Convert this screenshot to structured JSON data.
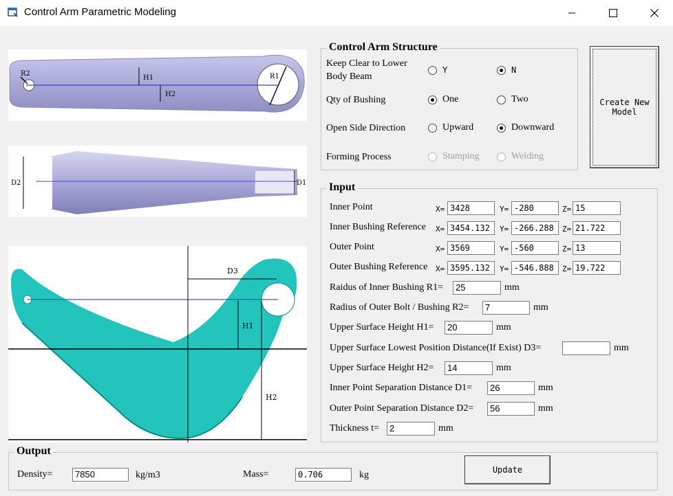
{
  "window": {
    "title": "Control Arm Parametric Modeling"
  },
  "figures": {
    "top": {
      "r2": "R2",
      "h1": "H1",
      "h2": "H2",
      "r1": "R1"
    },
    "side": {
      "d2": "D2",
      "d1": "D1"
    },
    "front": {
      "d3": "D3",
      "h1": "H1",
      "h2": "H2"
    }
  },
  "structure": {
    "title": "Control Arm Structure",
    "keep_clear_line1": "Keep Clear to Lower",
    "keep_clear_line2": "Body Beam",
    "keep_clear_options": [
      "Y",
      "N"
    ],
    "qty_label": "Qty of Bushing",
    "qty_options": [
      "One",
      "Two"
    ],
    "open_side_label": "Open Side Direction",
    "open_side_options": [
      "Upward",
      "Downward"
    ],
    "forming_label": "Forming Process",
    "forming_options": [
      "Stamping",
      "Welding"
    ],
    "create_button": "Create New Model"
  },
  "input": {
    "title": "Input",
    "inner_point": {
      "label": "Inner Point",
      "x": "3428",
      "y": "-280",
      "z": "15"
    },
    "inner_bushing_ref": {
      "label": "Inner Bushing Reference",
      "x": "3454.132",
      "y": "-266.288",
      "z": "21.722"
    },
    "outer_point": {
      "label": "Outer Point",
      "x": "3569",
      "y": "-560",
      "z": "13"
    },
    "outer_bushing_ref": {
      "label": "Outer Bushing Reference",
      "x": "3595.132",
      "y": "-546.888",
      "z": "19.722"
    },
    "r1": {
      "label": "Raidus of Inner Bushing R1=",
      "value": "25",
      "unit": "mm"
    },
    "r2": {
      "label": "Radius of Outer Bolt / Bushing R2=",
      "value": "7",
      "unit": "mm"
    },
    "h1": {
      "label": "Upper Surface Height H1=",
      "value": "20",
      "unit": "mm"
    },
    "d3": {
      "label": "Upper Surface Lowest Position Distance(If Exist) D3=",
      "value": "",
      "unit": "mm"
    },
    "h2": {
      "label": "Upper Surface Height H2=",
      "value": "14",
      "unit": "mm"
    },
    "d1": {
      "label": "Inner Point Separation Distance D1=",
      "value": "26",
      "unit": "mm"
    },
    "d2": {
      "label": "Outer Point Separation Distance D2=",
      "value": "56",
      "unit": "mm"
    },
    "t": {
      "label": "Thickness t=",
      "value": "2",
      "unit": "mm"
    }
  },
  "output": {
    "title": "Output",
    "density_label": "Density=",
    "density_value": "7850",
    "density_unit": "kg/m3",
    "mass_label": "Mass=",
    "mass_value": "0.706",
    "mass_unit": "kg",
    "update_button": "Update"
  }
}
